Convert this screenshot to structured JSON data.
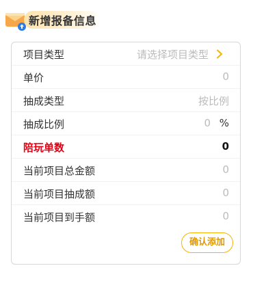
{
  "header": {
    "title": "新增报备信息",
    "icon": "envelope-upload-icon"
  },
  "form": {
    "rows": [
      {
        "label": "项目类型",
        "value": "请选择项目类型"
      },
      {
        "label": "单价",
        "value": "0"
      },
      {
        "label": "抽成类型",
        "value": "按比例"
      },
      {
        "label": "抽成比例",
        "value": "0",
        "unit": "%"
      },
      {
        "label": "陪玩单数",
        "value": "0"
      },
      {
        "label": "当前项目总金额",
        "value": "0"
      },
      {
        "label": "当前项目抽成额",
        "value": "0"
      },
      {
        "label": "当前项目到手额",
        "value": "0"
      }
    ],
    "confirm_label": "确认添加"
  },
  "colors": {
    "accent": "#f5b400",
    "accent_text": "#e19a00",
    "highlight_label": "#e60012",
    "placeholder": "#bbbbbb"
  }
}
